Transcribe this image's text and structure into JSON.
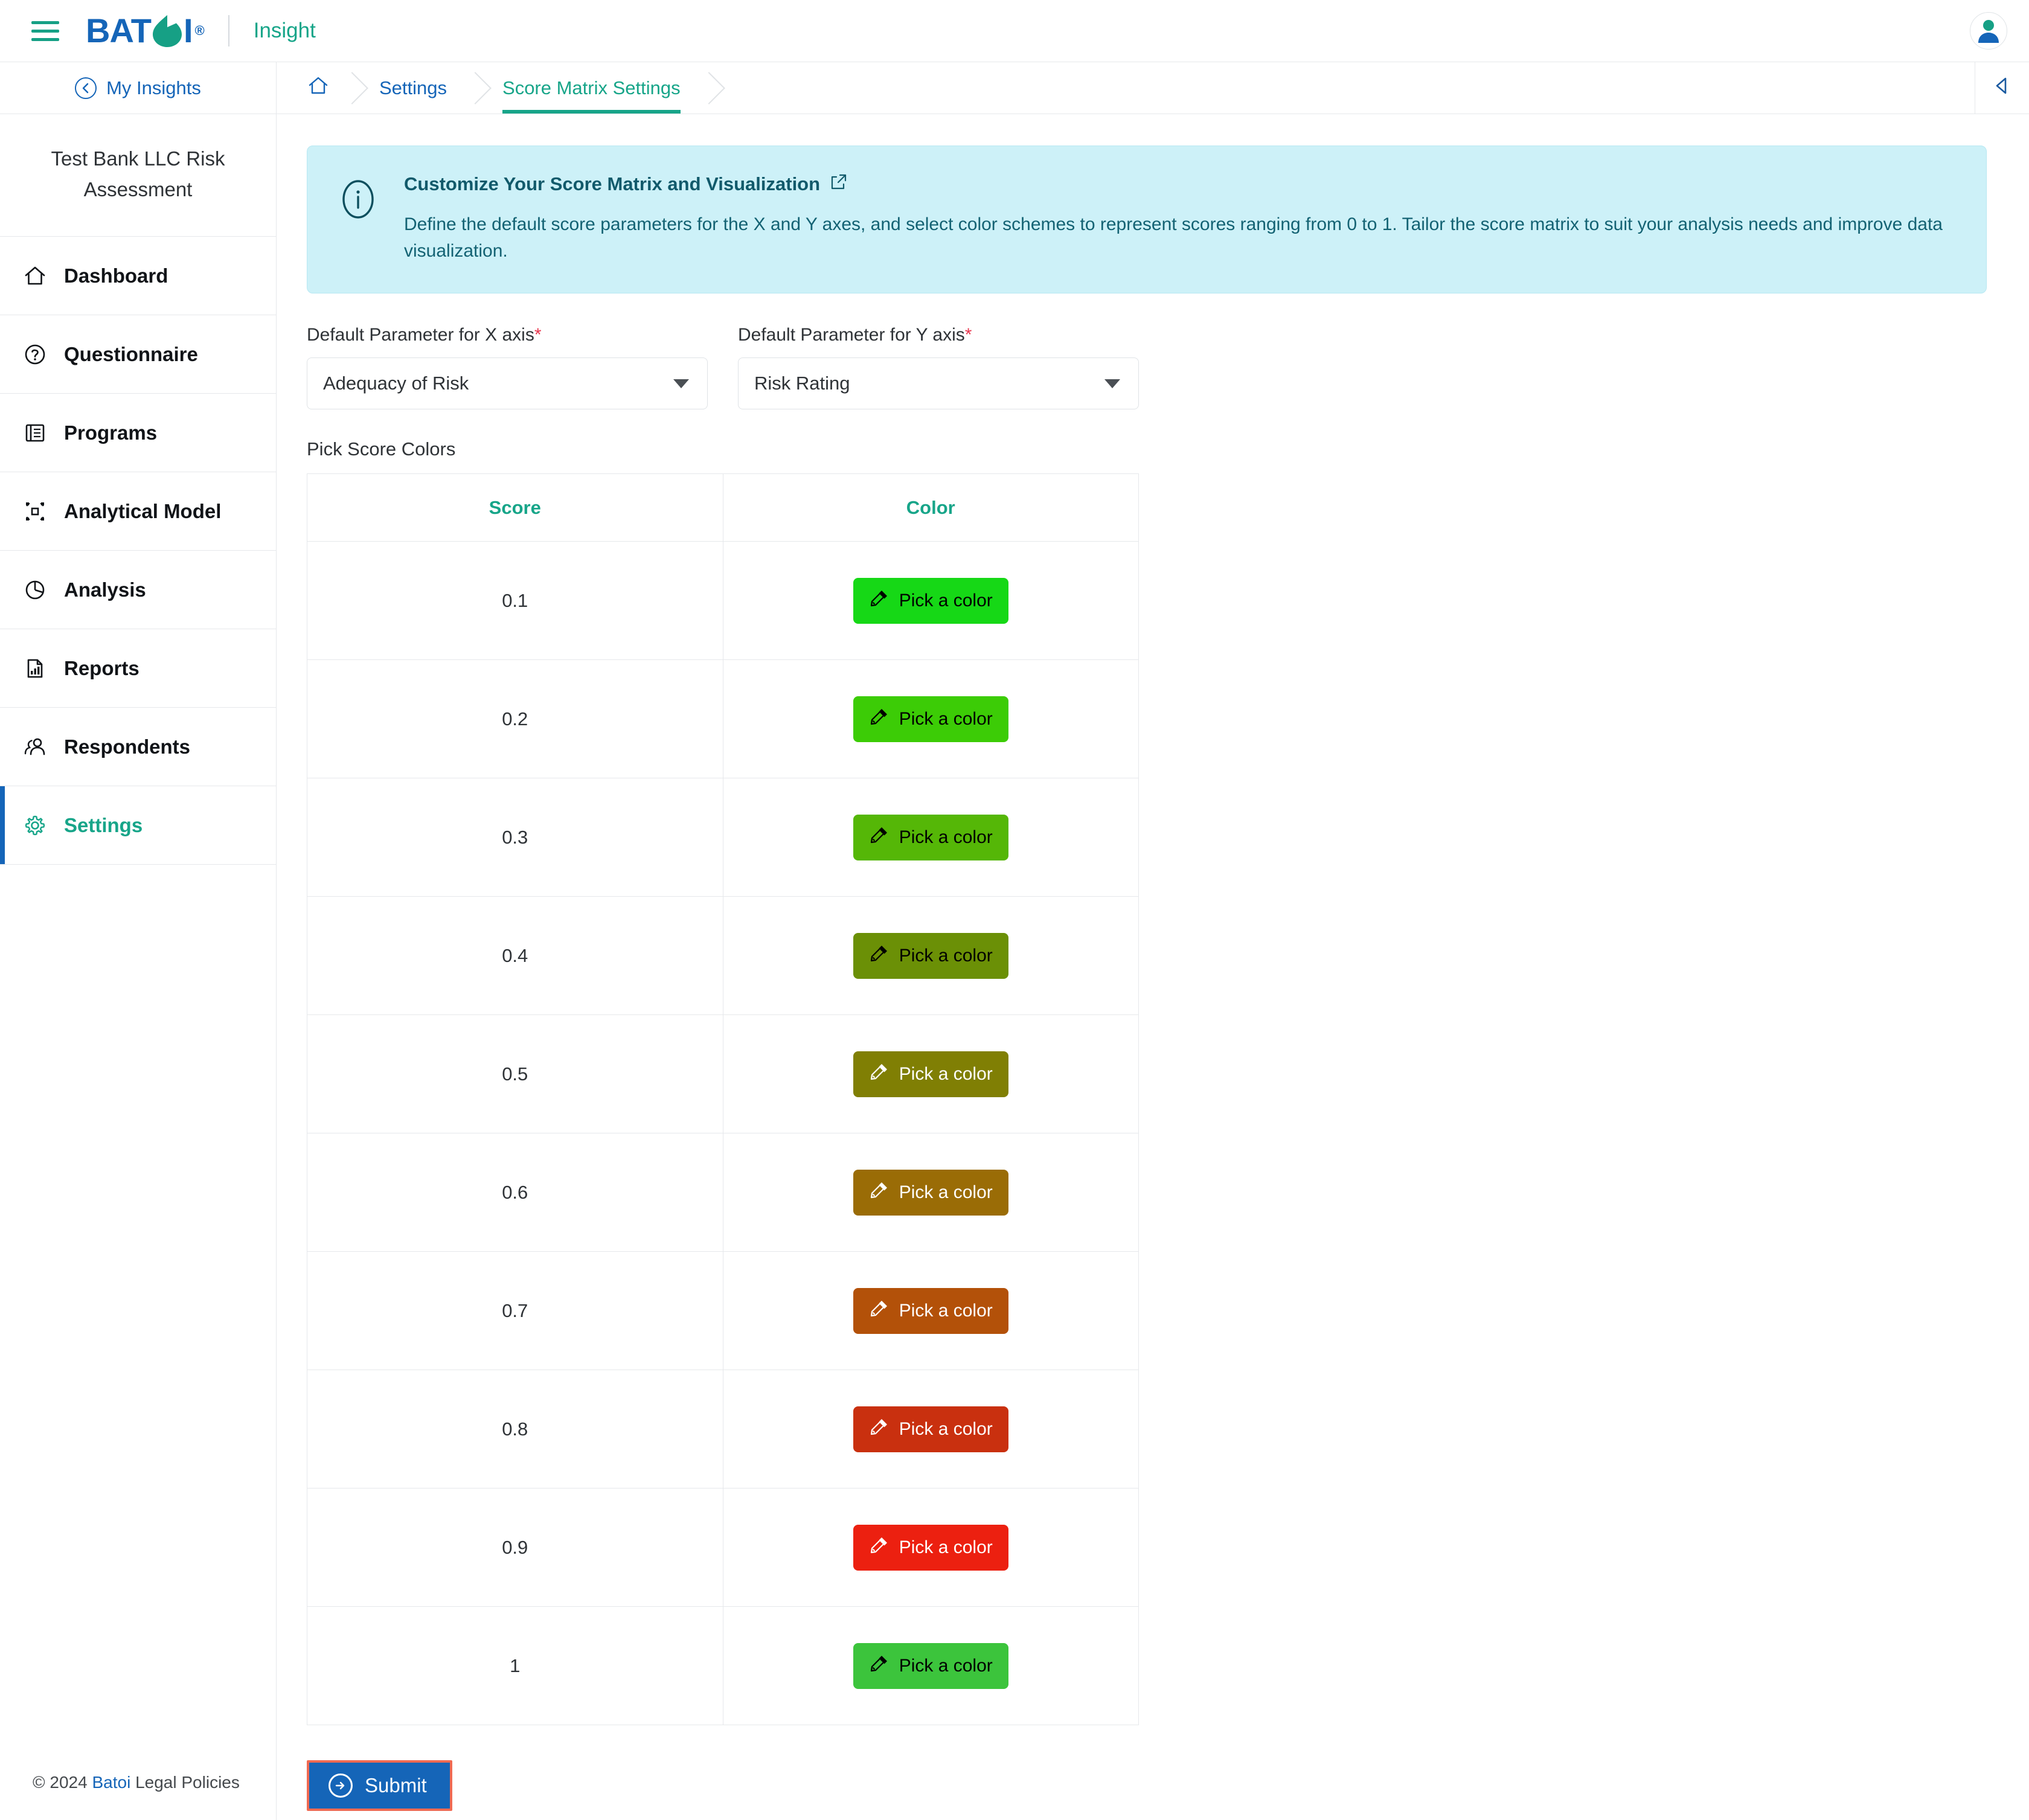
{
  "topbar": {
    "menu_icon": "hamburger-icon",
    "brand": "BAT",
    "brand_tail": "I",
    "brand_reg": "®",
    "product": "Insight",
    "avatar_icon": "user-avatar-icon"
  },
  "subbar": {
    "back_label": "My Insights",
    "back_icon": "circle-arrow-left-icon",
    "collapse_icon": "collapse-left-icon",
    "breadcrumbs": [
      {
        "label": "",
        "icon": "home-icon",
        "active": false
      },
      {
        "label": "Settings",
        "icon": "",
        "active": false
      },
      {
        "label": "Score Matrix Settings",
        "icon": "",
        "active": true
      }
    ]
  },
  "sidebar": {
    "assessment_title": "Test Bank LLC Risk Assessment",
    "items": [
      {
        "label": "Dashboard",
        "icon": "home-icon",
        "active": false
      },
      {
        "label": "Questionnaire",
        "icon": "question-circle-icon",
        "active": false
      },
      {
        "label": "Programs",
        "icon": "book-list-icon",
        "active": false
      },
      {
        "label": "Analytical Model",
        "icon": "bounding-box-icon",
        "active": false
      },
      {
        "label": "Analysis",
        "icon": "pie-chart-icon",
        "active": false
      },
      {
        "label": "Reports",
        "icon": "report-file-icon",
        "active": false
      },
      {
        "label": "Respondents",
        "icon": "people-icon",
        "active": false
      },
      {
        "label": "Settings",
        "icon": "gear-icon",
        "active": true
      }
    ],
    "footer": {
      "copyright": "© 2024 ",
      "brand_link": "Batoi",
      "legal": " Legal Policies"
    }
  },
  "info_banner": {
    "icon": "info-circle-icon",
    "title": "Customize Your Score Matrix and Visualization",
    "external_icon": "external-link-icon",
    "description": "Define the default score parameters for the X and Y axes, and select color schemes to represent scores ranging from 0 to 1. Tailor the score matrix to suit your analysis needs and improve data visualization."
  },
  "form": {
    "x_axis": {
      "label": "Default Parameter for X axis",
      "required": "*",
      "value": "Adequacy of Risk"
    },
    "y_axis": {
      "label": "Default Parameter for Y axis",
      "required": "*",
      "value": "Risk Rating"
    },
    "pick_title": "Pick Score Colors",
    "table": {
      "columns": [
        "Score",
        "Color"
      ],
      "button_label": "Pick a color",
      "button_icon": "eyedropper-icon",
      "rows": [
        {
          "score": "0.1",
          "color": "#16d816",
          "text_color": "#000000"
        },
        {
          "score": "0.2",
          "color": "#3ccc06",
          "text_color": "#000000"
        },
        {
          "score": "0.3",
          "color": "#55b707",
          "text_color": "#000000"
        },
        {
          "score": "0.4",
          "color": "#6b9006",
          "text_color": "#000000"
        },
        {
          "score": "0.5",
          "color": "#807f04",
          "text_color": "#ffffff"
        },
        {
          "score": "0.6",
          "color": "#9a6c06",
          "text_color": "#ffffff"
        },
        {
          "score": "0.7",
          "color": "#b35109",
          "text_color": "#ffffff"
        },
        {
          "score": "0.8",
          "color": "#c9300f",
          "text_color": "#ffffff"
        },
        {
          "score": "0.9",
          "color": "#ec2010",
          "text_color": "#ffffff"
        },
        {
          "score": "1",
          "color": "#3cc43c",
          "text_color": "#000000"
        }
      ]
    },
    "submit": {
      "label": "Submit",
      "icon": "arrow-right-circle-icon"
    }
  },
  "colors": {
    "brand_blue": "#1565b8",
    "brand_teal": "#17a589",
    "info_bg": "#cdf1f8",
    "info_text": "#136273",
    "required_red": "#e8384f",
    "submit_focus": "#f16a52"
  }
}
